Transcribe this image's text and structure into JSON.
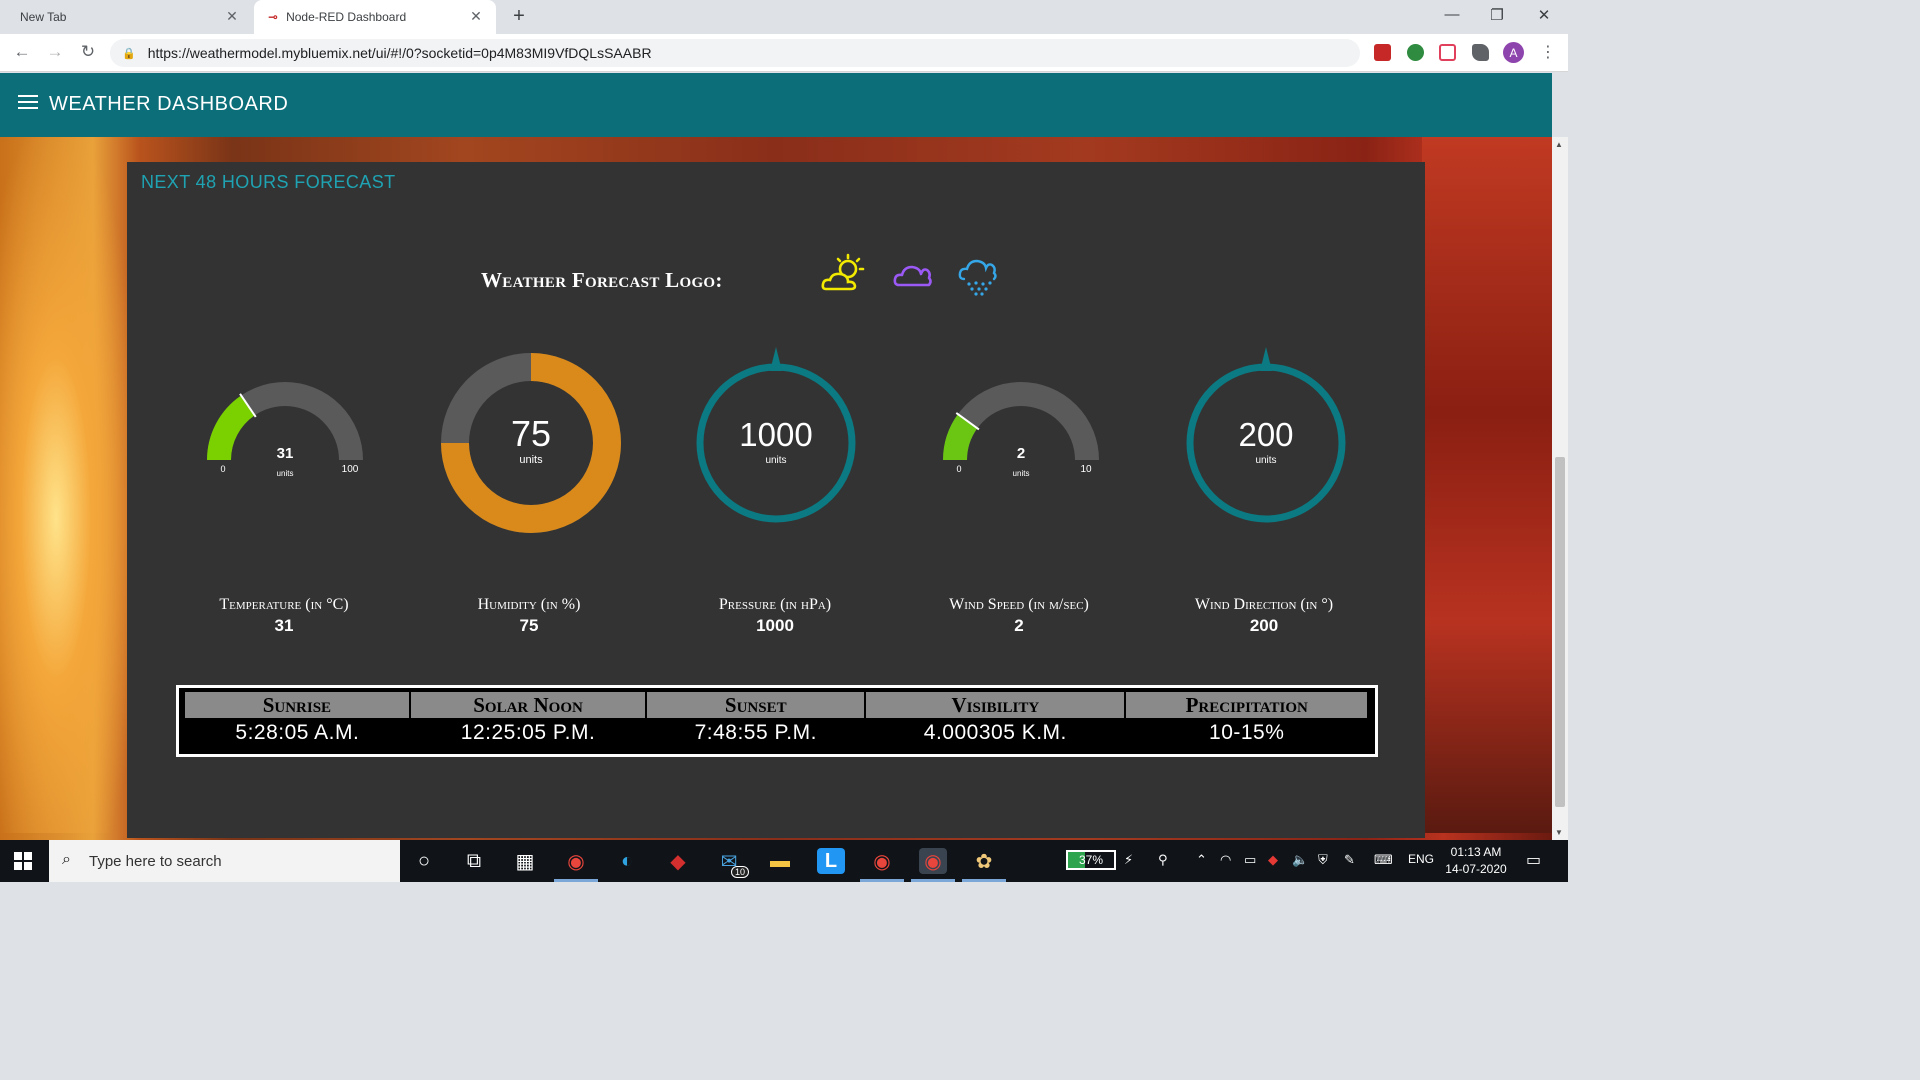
{
  "browser": {
    "tabs": [
      {
        "title": "New Tab",
        "active": false
      },
      {
        "title": "Node-RED Dashboard",
        "active": true
      }
    ],
    "new_tab_icon": "plus-icon",
    "window_controls": [
      "minimize-icon",
      "restore-icon",
      "close-icon"
    ],
    "url": "https://weathermodel.mybluemix.net/ui/#!/0?socketid=0p4M83MI9VfDQLsSAABR",
    "profile_initial": "A",
    "extensions": [
      {
        "name": "mcafee-icon",
        "color": "#c62828"
      },
      {
        "name": "shield-icon",
        "color": "#2e8b3f"
      },
      {
        "name": "pocket-icon",
        "color": "#e0405b"
      },
      {
        "name": "puzzle-icon",
        "color": "#5f6368"
      }
    ]
  },
  "app": {
    "title": "WEATHER DASHBOARD",
    "menu_icon": "hamburger-icon",
    "header_color": "#0b6e78"
  },
  "panel": {
    "title": "NEXT 48 HOURS FORECAST",
    "logo_label": "Weather Forecast Logo:",
    "weather_icons": [
      {
        "name": "partly-sunny-icon",
        "color": "#f2e900"
      },
      {
        "name": "cloud-icon",
        "color": "#9b59f5"
      },
      {
        "name": "snow-cloud-icon",
        "color": "#35a7e8"
      }
    ]
  },
  "gauges": [
    {
      "id": "temperature",
      "type": "half",
      "value": "31",
      "min": "0",
      "max": "100",
      "units": "units",
      "fraction": 0.31,
      "color": "#7bd000",
      "label": "Temperature (in °C)",
      "display": "31"
    },
    {
      "id": "humidity",
      "type": "donut",
      "value": "75",
      "units": "units",
      "fraction": 0.75,
      "color": "#d98a1a",
      "label": "Humidity (in %)",
      "display": "75"
    },
    {
      "id": "pressure",
      "type": "compass",
      "value": "1000",
      "units": "units",
      "fraction": 0.0,
      "color": "#0b7a82",
      "label": "Pressure (in hPa)",
      "display": "1000"
    },
    {
      "id": "wind-speed",
      "type": "half",
      "value": "2",
      "min": "0",
      "max": "10",
      "units": "units",
      "fraction": 0.2,
      "color": "#6ac613",
      "label": "Wind Speed (in m/sec)",
      "display": "2"
    },
    {
      "id": "wind-direction",
      "type": "compass",
      "value": "200",
      "units": "units",
      "fraction": 0.0,
      "color": "#0b7a82",
      "label": "Wind Direction (in °)",
      "display": "200"
    }
  ],
  "sun_table": {
    "headers": [
      "Sunrise",
      "Solar Noon",
      "Sunset",
      "Visibility",
      "Precipitation"
    ],
    "values": [
      "5:28:05 A.M.",
      "12:25:05 P.M.",
      "7:48:55 P.M.",
      "4.000305 K.M.",
      "10-15%"
    ]
  },
  "taskbar": {
    "search_placeholder": "Type here to search",
    "apps": [
      {
        "name": "cortana-icon"
      },
      {
        "name": "task-view-icon"
      },
      {
        "name": "store-icon"
      },
      {
        "name": "chrome-icon"
      },
      {
        "name": "edge-icon"
      },
      {
        "name": "mcafee-icon"
      },
      {
        "name": "mail-icon",
        "badge": "10"
      },
      {
        "name": "file-explorer-icon"
      },
      {
        "name": "l-app-icon",
        "glyph": "L"
      },
      {
        "name": "chrome-icon-2"
      },
      {
        "name": "chrome-icon-3"
      },
      {
        "name": "paint-icon"
      }
    ],
    "battery": "37%",
    "battery_fraction": 0.37,
    "language": "ENG",
    "time": "01:13 AM",
    "date": "14-07-2020"
  }
}
